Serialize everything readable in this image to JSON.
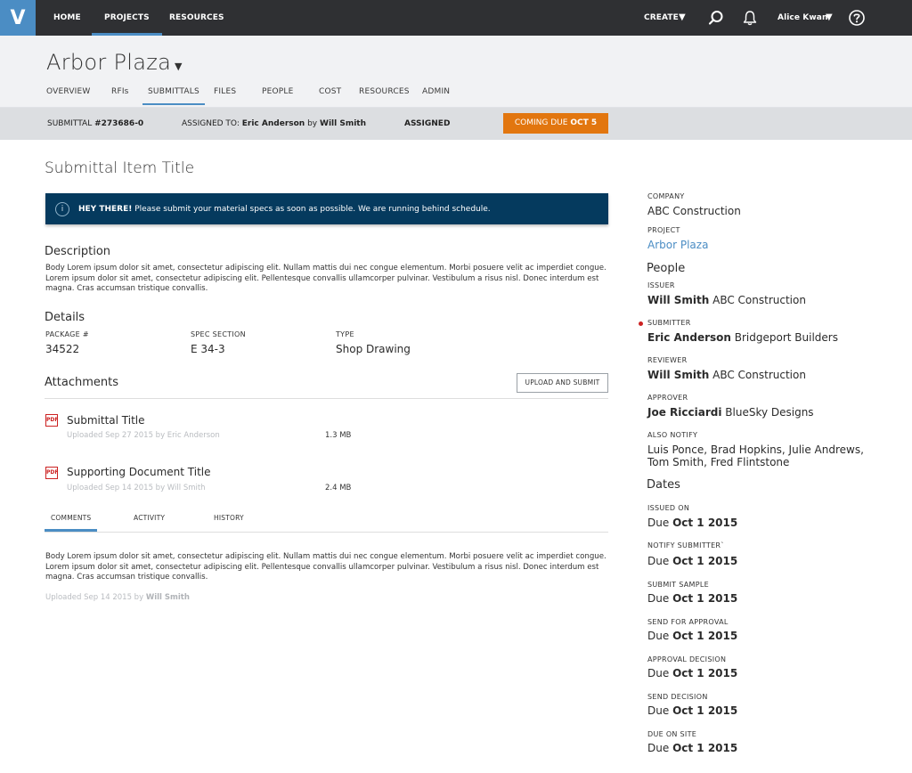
{
  "topbar": {
    "logo": "V",
    "nav": [
      "HOME",
      "PROJECTS",
      "RESOURCES"
    ],
    "create_label": "CREATE",
    "user_name": "Alice Kwan"
  },
  "project": {
    "title": "Arbor Plaza",
    "subnav": [
      "OVERVIEW",
      "RFIs",
      "SUBMITTALS",
      "FILES",
      "PEOPLE",
      "COST",
      "RESOURCES",
      "ADMIN"
    ]
  },
  "status": {
    "submittal_label": "SUBMITTAL",
    "submittal_number": "#273686-0",
    "assigned_label": "ASSIGNED TO:",
    "assignee": "Eric Anderson",
    "by_label": "by",
    "assigner": "Will Smith",
    "state": "ASSIGNED",
    "due_label": "COMING DUE",
    "due_date": "OCT 5"
  },
  "main": {
    "item_title": "Submittal Item Title",
    "alert_bold": "HEY THERE!",
    "alert_text": " Please submit your material specs as soon as possible. We are running behind schedule.",
    "description_heading": "Description",
    "description_text": "Body Lorem ipsum dolor sit amet, consectetur adipiscing elit. Nullam mattis dui nec congue elementum. Morbi posuere velit ac imperdiet congue. Lorem ipsum dolor sit amet, consectetur adipiscing elit. Pellentesque convallis ullamcorper pulvinar. Vestibulum a risus nisl. Donec interdum est magna. Cras accumsan tristique convallis.",
    "details_heading": "Details",
    "details": [
      {
        "label": "PACKAGE #",
        "value": "34522"
      },
      {
        "label": "SPEC SECTION",
        "value": "E 34-3"
      },
      {
        "label": "TYPE",
        "value": "Shop Drawing"
      }
    ],
    "attachments_heading": "Attachments",
    "upload_button": "UPLOAD AND SUBMIT",
    "attachments": [
      {
        "title": "Submittal Title",
        "meta": "Uploaded Sep 27 2015 by Eric Anderson",
        "size": "1.3 MB"
      },
      {
        "title": "Supporting Document Title",
        "meta": "Uploaded Sep 14 2015 by Will Smith",
        "size": "2.4 MB"
      }
    ],
    "pdf_label": "PDF",
    "tabs": [
      "COMMENTS",
      "ACTIVITY",
      "HISTORY"
    ],
    "comment_text": "Body Lorem ipsum dolor sit amet, consectetur adipiscing elit. Nullam mattis dui nec congue elementum. Morbi posuere velit ac imperdiet congue. Lorem ipsum dolor sit amet, consectetur adipiscing elit. Pellentesque convallis ullamcorper pulvinar. Vestibulum a risus nisl. Donec interdum est magna. Cras accumsan tristique convallis.",
    "comment_meta": "Uploaded Sep 14 2015 by",
    "comment_author": "Will Smith"
  },
  "sidebar": {
    "company_label": "COMPANY",
    "company": "ABC Construction",
    "project_label": "PROJECT",
    "project": "Arbor Plaza",
    "people_heading": "People",
    "people": [
      {
        "role": "ISSUER",
        "name": "Will Smith",
        "company": "ABC Construction"
      },
      {
        "role": "SUBMITTER",
        "name": "Eric Anderson",
        "company": "Bridgeport Builders"
      },
      {
        "role": "REVIEWER",
        "name": "Will Smith",
        "company": "ABC Construction"
      },
      {
        "role": "APPROVER",
        "name": "Joe Ricciardi",
        "company": "BlueSky Designs"
      }
    ],
    "also_notify_label": "ALSO NOTIFY",
    "also_notify_line1": "Luis Ponce, Brad Hopkins, Julie Andrews,",
    "also_notify_line2": "Tom Smith, Fred Flintstone",
    "dates_heading": "Dates",
    "due_prefix": "Due",
    "dates": [
      {
        "label": "ISSUED ON",
        "date": "Oct 1 2015"
      },
      {
        "label": "NOTIFY SUBMITTER`",
        "date": "Oct 1 2015"
      },
      {
        "label": "SUBMIT SAMPLE",
        "date": "Oct 1 2015"
      },
      {
        "label": "SEND FOR APPROVAL",
        "date": "Oct 1 2015"
      },
      {
        "label": "APPROVAL DECISION",
        "date": "Oct 1 2015"
      },
      {
        "label": "SEND DECISION",
        "date": "Oct 1 2015"
      },
      {
        "label": "DUE ON SITE",
        "date": "Oct 1 2015"
      }
    ]
  },
  "colors": {
    "accent": "#4b8dc4",
    "topbar": "#2f3033",
    "alert": "#053a5e",
    "due_badge": "#e2760f",
    "required_dot": "#cc2222"
  },
  "icons": {
    "logo": "v-logo",
    "search": "search-icon",
    "notifications": "bell-icon",
    "help": "help-icon",
    "info": "info-icon",
    "pdf": "pdf-file-icon"
  }
}
